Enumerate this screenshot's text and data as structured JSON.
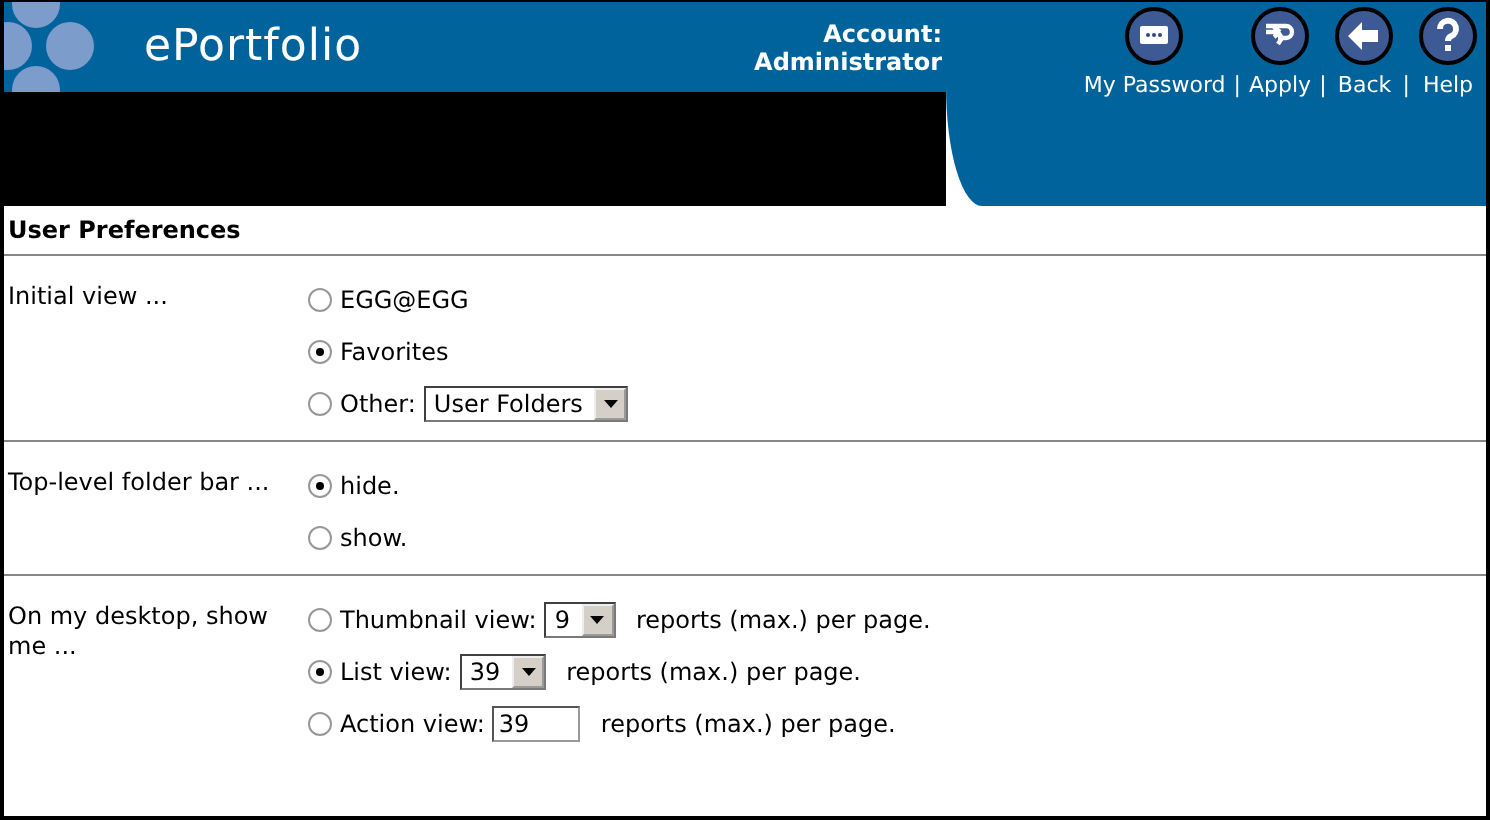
{
  "header": {
    "title": "ePortfolio",
    "account_label": "Account:",
    "account_name": "Administrator",
    "nav": [
      {
        "kind": "password",
        "label": "My Password",
        "separator": "|"
      },
      {
        "kind": "apply",
        "label": "Apply",
        "separator": "|"
      },
      {
        "kind": "back",
        "label": "Back",
        "separator": "|"
      },
      {
        "kind": "help",
        "label": "Help"
      }
    ]
  },
  "page_title": "User Preferences",
  "sections": [
    {
      "label": "Initial view ...",
      "options": [
        {
          "label": "EGG@EGG",
          "selected": false
        },
        {
          "label": "Favorites",
          "selected": true
        },
        {
          "label": "Other:",
          "selected": false,
          "control": {
            "kind": "select",
            "value": "User Folders"
          }
        }
      ]
    },
    {
      "label": "Top-level folder bar ...",
      "options": [
        {
          "label": "hide.",
          "selected": true
        },
        {
          "label": "show.",
          "selected": false
        }
      ]
    },
    {
      "label": "On my desktop, show me ...",
      "options": [
        {
          "label": "Thumbnail view:",
          "selected": false,
          "control": {
            "kind": "select",
            "value": "9"
          },
          "suffix": "reports (max.) per page."
        },
        {
          "label": "List view:",
          "selected": true,
          "control": {
            "kind": "select",
            "value": "39"
          },
          "suffix": "reports (max.) per page."
        },
        {
          "label": "Action view:",
          "selected": false,
          "control": {
            "kind": "input",
            "value": "39"
          },
          "suffix": "reports (max.) per page."
        }
      ]
    }
  ]
}
